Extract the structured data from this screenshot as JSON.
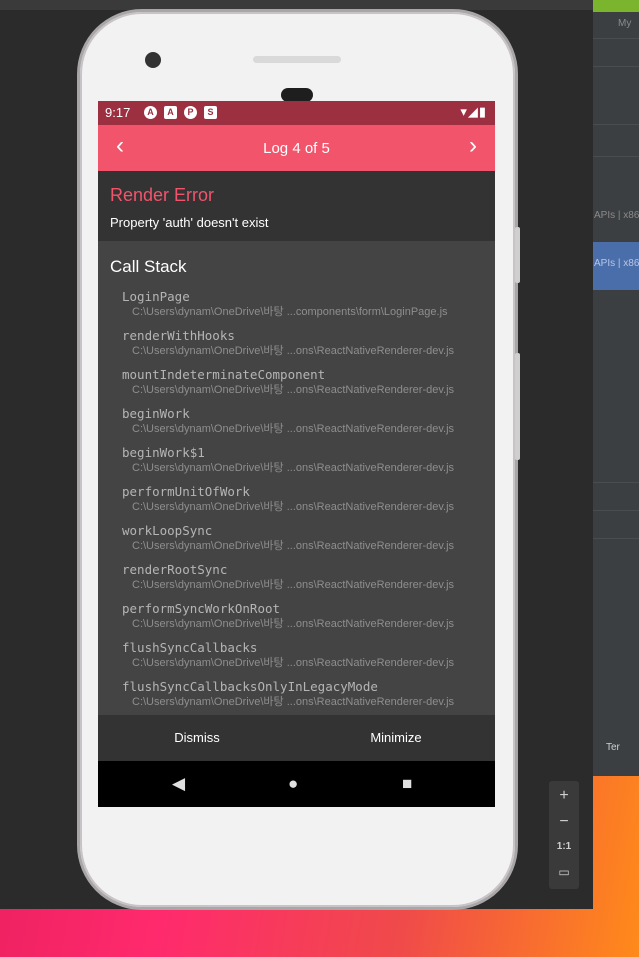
{
  "background": {
    "right_panel_texts": [
      "My",
      "APIs | x86",
      "APIs | x86",
      "Ter"
    ]
  },
  "emulator_controls": {
    "zoom_in": "+",
    "zoom_out": "−",
    "ratio": "1:1"
  },
  "status_bar": {
    "time": "9:17",
    "app_icons": [
      "A",
      "A",
      "P",
      "S"
    ]
  },
  "header": {
    "title": "Log 4 of 5",
    "prev_icon": "‹",
    "next_icon": "›"
  },
  "error": {
    "title": "Render Error",
    "message": "Property 'auth' doesn't exist"
  },
  "call_stack": {
    "title": "Call Stack",
    "frames": [
      {
        "fn": "LoginPage",
        "path": "C:\\Users\\dynam\\OneDrive\\바탕 ...components\\form\\LoginPage.js"
      },
      {
        "fn": "renderWithHooks",
        "path": "C:\\Users\\dynam\\OneDrive\\바탕 ...ons\\ReactNativeRenderer-dev.js"
      },
      {
        "fn": "mountIndeterminateComponent",
        "path": "C:\\Users\\dynam\\OneDrive\\바탕 ...ons\\ReactNativeRenderer-dev.js"
      },
      {
        "fn": "beginWork",
        "path": "C:\\Users\\dynam\\OneDrive\\바탕 ...ons\\ReactNativeRenderer-dev.js"
      },
      {
        "fn": "beginWork$1",
        "path": "C:\\Users\\dynam\\OneDrive\\바탕 ...ons\\ReactNativeRenderer-dev.js"
      },
      {
        "fn": "performUnitOfWork",
        "path": "C:\\Users\\dynam\\OneDrive\\바탕 ...ons\\ReactNativeRenderer-dev.js"
      },
      {
        "fn": "workLoopSync",
        "path": "C:\\Users\\dynam\\OneDrive\\바탕 ...ons\\ReactNativeRenderer-dev.js"
      },
      {
        "fn": "renderRootSync",
        "path": "C:\\Users\\dynam\\OneDrive\\바탕 ...ons\\ReactNativeRenderer-dev.js"
      },
      {
        "fn": "performSyncWorkOnRoot",
        "path": "C:\\Users\\dynam\\OneDrive\\바탕 ...ons\\ReactNativeRenderer-dev.js"
      },
      {
        "fn": "flushSyncCallbacks",
        "path": "C:\\Users\\dynam\\OneDrive\\바탕 ...ons\\ReactNativeRenderer-dev.js"
      },
      {
        "fn": "flushSyncCallbacksOnlyInLegacyMode",
        "path": "C:\\Users\\dynam\\OneDrive\\바탕 ...ons\\ReactNativeRenderer-dev.js"
      }
    ]
  },
  "footer": {
    "dismiss": "Dismiss",
    "minimize": "Minimize"
  },
  "nav_bar": {
    "back": "◀",
    "home": "●",
    "recents": "■"
  },
  "colors": {
    "accent": "#f1546b",
    "status_bar": "#9c2f40"
  }
}
